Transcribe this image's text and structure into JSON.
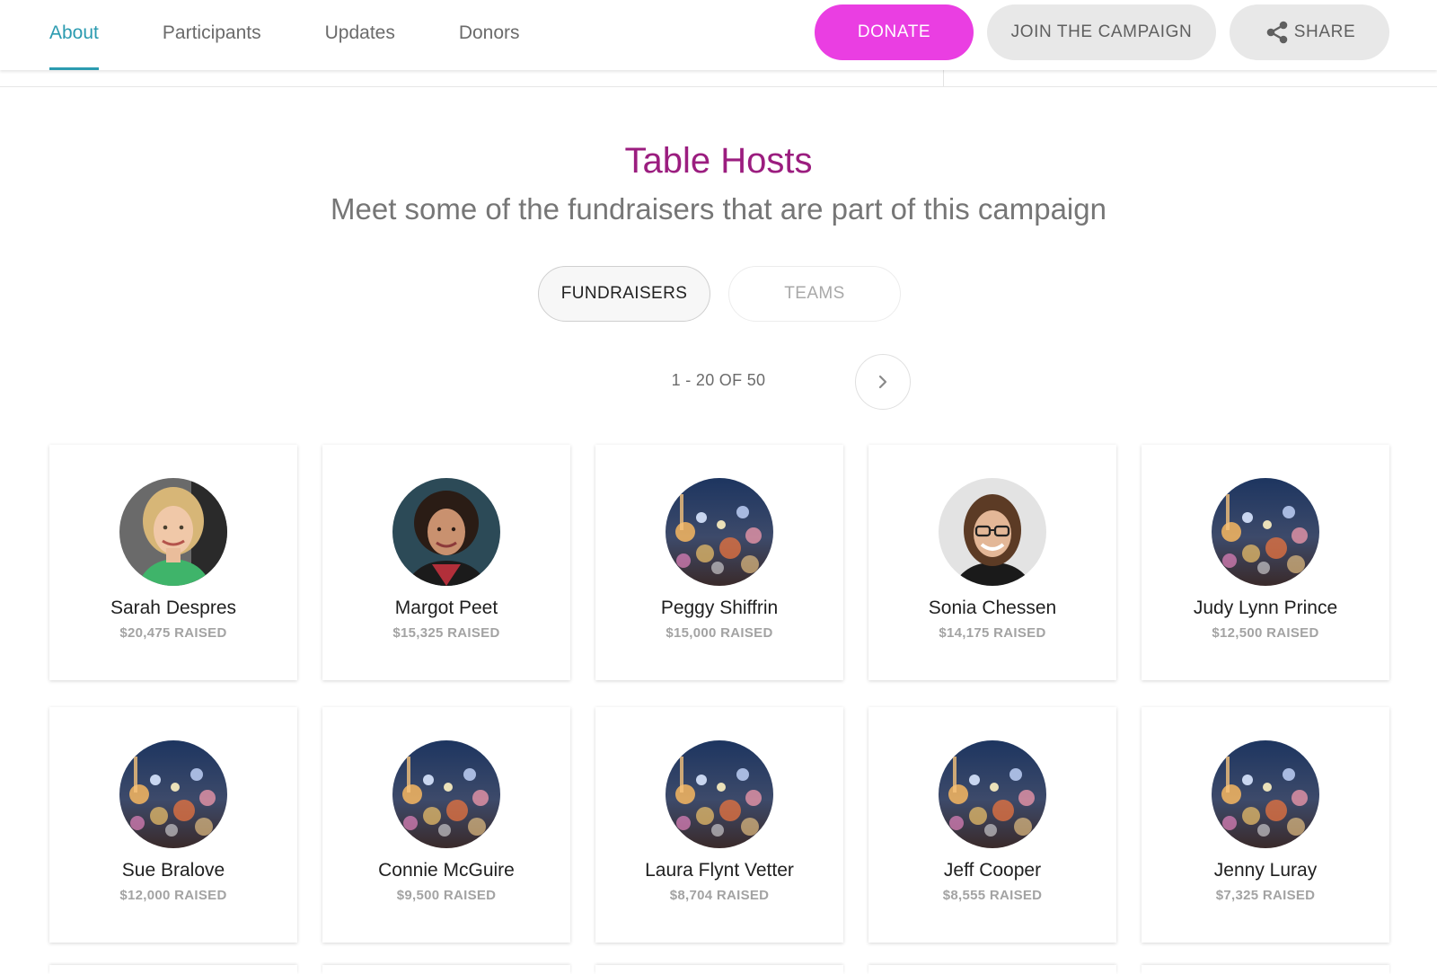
{
  "nav": {
    "tabs": [
      "About",
      "Participants",
      "Updates",
      "Donors"
    ],
    "active_tab": "About",
    "donate_label": "DONATE",
    "join_label": "JOIN THE CAMPAIGN",
    "share_label": "SHARE"
  },
  "section": {
    "title": "Table Hosts",
    "subtitle": "Meet some of the fundraisers that are part of this campaign"
  },
  "toggle": {
    "fundraisers_label": "FUNDRAISERS",
    "teams_label": "TEAMS",
    "selected": "FUNDRAISERS"
  },
  "pagination": {
    "range_text": "1 - 20 OF 50"
  },
  "fundraisers": [
    {
      "name": "Sarah Despres",
      "raised": "$20,475 RAISED",
      "avatar": "photo-woman-blonde"
    },
    {
      "name": "Margot Peet",
      "raised": "$15,325 RAISED",
      "avatar": "photo-woman-curly"
    },
    {
      "name": "Peggy Shiffrin",
      "raised": "$15,000 RAISED",
      "avatar": "city-lights-default"
    },
    {
      "name": "Sonia Chessen",
      "raised": "$14,175 RAISED",
      "avatar": "photo-woman-glasses"
    },
    {
      "name": "Judy Lynn Prince",
      "raised": "$12,500 RAISED",
      "avatar": "city-lights-default"
    },
    {
      "name": "Sue Bralove",
      "raised": "$12,000 RAISED",
      "avatar": "city-lights-default"
    },
    {
      "name": "Connie McGuire",
      "raised": "$9,500 RAISED",
      "avatar": "city-lights-default"
    },
    {
      "name": "Laura Flynt Vetter",
      "raised": "$8,704 RAISED",
      "avatar": "city-lights-default"
    },
    {
      "name": "Jeff Cooper",
      "raised": "$8,555 RAISED",
      "avatar": "city-lights-default"
    },
    {
      "name": "Jenny Luray",
      "raised": "$7,325 RAISED",
      "avatar": "city-lights-default"
    }
  ],
  "colors": {
    "accent_tab": "#2b9bb0",
    "donate": "#ea3ee2",
    "title": "#9b1d7f"
  }
}
